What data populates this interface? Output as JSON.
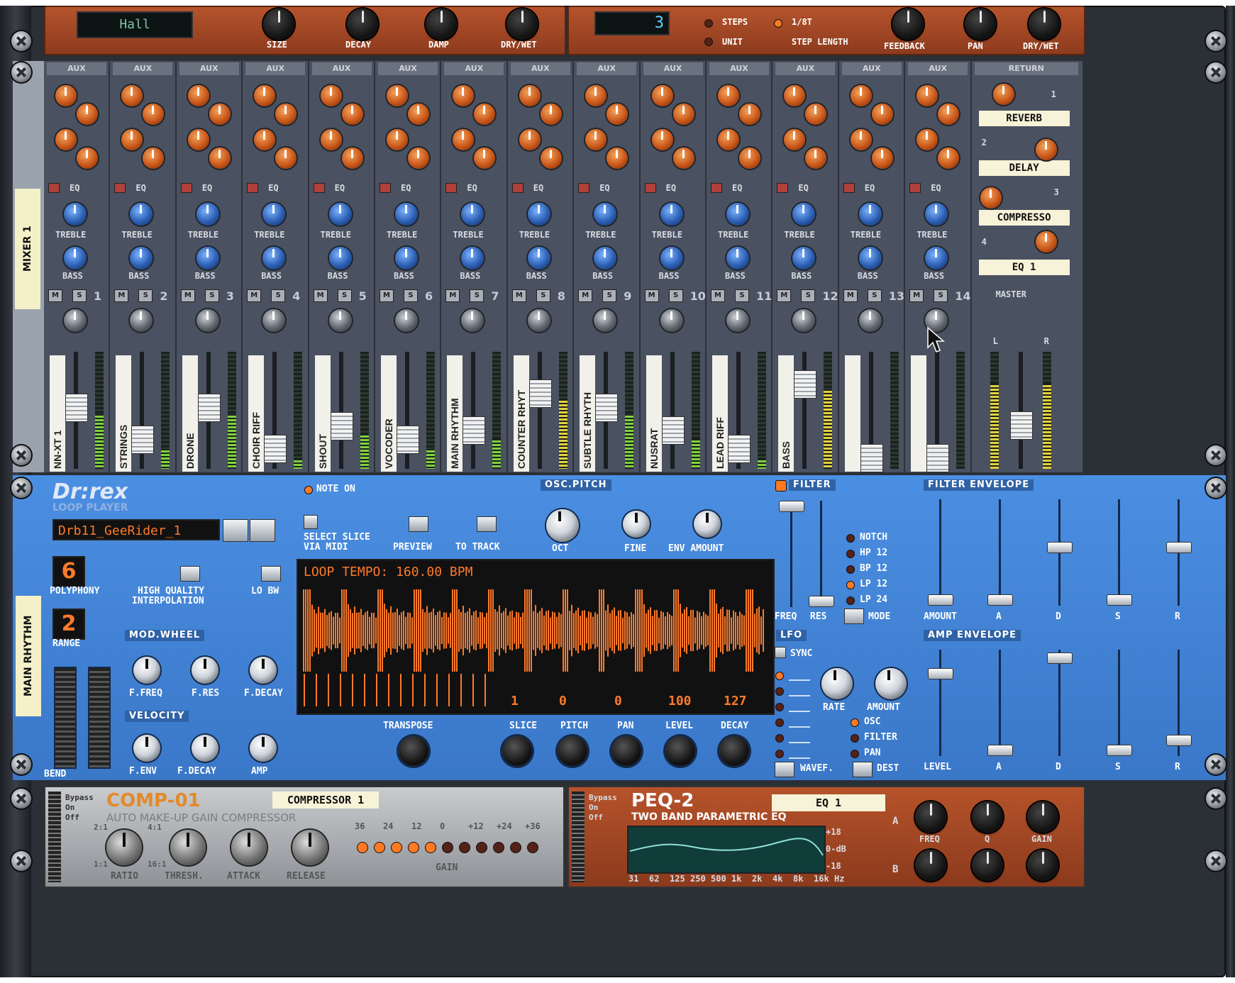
{
  "reverb": {
    "program": "Hall",
    "labels": [
      "SIZE",
      "DECAY",
      "DAMP",
      "DRY/WET"
    ]
  },
  "delay": {
    "display": "3",
    "steps_label": "STEPS",
    "unit_label": "UNIT",
    "time_label": "1/8T",
    "step_length_label": "STEP LENGTH",
    "labels": [
      "FEEDBACK",
      "PAN",
      "DRY/WET"
    ],
    "pan_l": "L",
    "pan_r": "R"
  },
  "mixer": {
    "device_label": "MIXER 1",
    "aux_label": "AUX",
    "eq_label": "EQ",
    "treble_label": "TREBLE",
    "bass_label": "BASS",
    "mute_label": "M",
    "solo_label": "S",
    "channels": [
      {
        "num": "1",
        "name": "NN-XT 1",
        "level": 0.55
      },
      {
        "num": "2",
        "name": "STRINGS",
        "level": 0.2
      },
      {
        "num": "3",
        "name": "DRONE",
        "level": 0.55
      },
      {
        "num": "4",
        "name": "CHOIR RIFF",
        "level": 0.1
      },
      {
        "num": "5",
        "name": "SHOUT",
        "level": 0.35
      },
      {
        "num": "6",
        "name": "VOCODER",
        "level": 0.2
      },
      {
        "num": "7",
        "name": "MAIN RHYTHM",
        "level": 0.3
      },
      {
        "num": "8",
        "name": "COUNTER RHYT",
        "level": 0.7
      },
      {
        "num": "9",
        "name": "SUBTLE RHYTH",
        "level": 0.55
      },
      {
        "num": "10",
        "name": "NUSRAT",
        "level": 0.3
      },
      {
        "num": "11",
        "name": "LEAD RIFF",
        "level": 0.1
      },
      {
        "num": "12",
        "name": "BASS",
        "level": 0.8
      },
      {
        "num": "13",
        "name": "",
        "level": 0
      },
      {
        "num": "14",
        "name": "",
        "level": 0
      }
    ],
    "return": {
      "header": "RETURN",
      "num": "1",
      "slots": [
        "REVERB",
        "DELAY",
        "COMPRESSO",
        "EQ 1"
      ],
      "nums": [
        "2",
        "3",
        "4"
      ],
      "master_label": "MASTER",
      "l": "L",
      "r": "R"
    }
  },
  "drrex": {
    "device_label": "MAIN RHYTHM",
    "logo": "Dr:rex",
    "subtitle": "LOOP PLAYER",
    "patch_name": "Drb11_GeeRider_1",
    "note_on": "NOTE ON",
    "select_slice": "SELECT SLICE",
    "via_midi": "VIA MIDI",
    "preview": "PREVIEW",
    "to_track": "TO TRACK",
    "osc_pitch": "OSC.PITCH",
    "oct": "OCT",
    "fine": "FINE",
    "env_amount": "ENV AMOUNT",
    "polyphony_value": "6",
    "polyphony": "POLYPHONY",
    "hq_interp": "HIGH QUALITY",
    "hq_interp2": "INTERPOLATION",
    "lo_bw": "LO BW",
    "range_value": "2",
    "range": "RANGE",
    "mod_wheel": "MOD.WHEEL",
    "velocity": "VELOCITY",
    "mod_labels": [
      "F.FREQ",
      "F.RES",
      "F.DECAY"
    ],
    "vel_labels": [
      "F.ENV",
      "F.DECAY",
      "AMP"
    ],
    "bend": "BEND",
    "loop_tempo": "LOOP TEMPO: 160.00 BPM",
    "slice_values": [
      "1",
      "0",
      "0",
      "100",
      "127"
    ],
    "transpose": "TRANSPOSE",
    "slice_labels": [
      "SLICE",
      "PITCH",
      "PAN",
      "LEVEL",
      "DECAY"
    ],
    "filter": "FILTER",
    "filter_modes": [
      "NOTCH",
      "HP 12",
      "BP 12",
      "LP 12",
      "LP 24"
    ],
    "active_mode": "LP 12",
    "freq": "FREQ",
    "res": "RES",
    "mode": "MODE",
    "filter_env": "FILTER ENVELOPE",
    "env_labels": [
      "AMOUNT",
      "A",
      "D",
      "S",
      "R"
    ],
    "lfo": "LFO",
    "sync": "SYNC",
    "rate": "RATE",
    "amount": "AMOUNT",
    "dest": [
      "OSC",
      "FILTER",
      "PAN"
    ],
    "wavef": "WAVEF.",
    "dest_label": "DEST",
    "amp_env": "AMP ENVELOPE",
    "amp_labels": [
      "LEVEL",
      "A",
      "D",
      "S",
      "R"
    ]
  },
  "comp": {
    "bypass": [
      "Bypass",
      "On",
      "Off"
    ],
    "title": "COMP-01",
    "subtitle": "AUTO MAKE-UP GAIN COMPRESSOR",
    "tape": "COMPRESSOR 1",
    "knobs": [
      "RATIO",
      "THRESH.",
      "ATTACK",
      "RELEASE"
    ],
    "ratio_min": "1:1",
    "ratio_max": "16:1",
    "ratio_a": "2:1",
    "ratio_b": "4:1",
    "gain_scale": [
      "36",
      "24",
      "12",
      "0",
      "+12",
      "+24",
      "+36"
    ],
    "gain_label": "GAIN"
  },
  "peq": {
    "bypass": [
      "Bypass",
      "On",
      "Off"
    ],
    "title": "PEQ-2",
    "subtitle": "TWO BAND PARAMETRIC EQ",
    "tape": "EQ 1",
    "scale": [
      "+18",
      "0-dB",
      "-18"
    ],
    "freqs": [
      "31",
      "62",
      "125",
      "250",
      "500",
      "1k",
      "2k",
      "4k",
      "8k",
      "16k",
      "Hz"
    ],
    "band_a": "A",
    "band_b": "B",
    "knob_labels": [
      "FREQ",
      "Q",
      "GAIN"
    ]
  }
}
